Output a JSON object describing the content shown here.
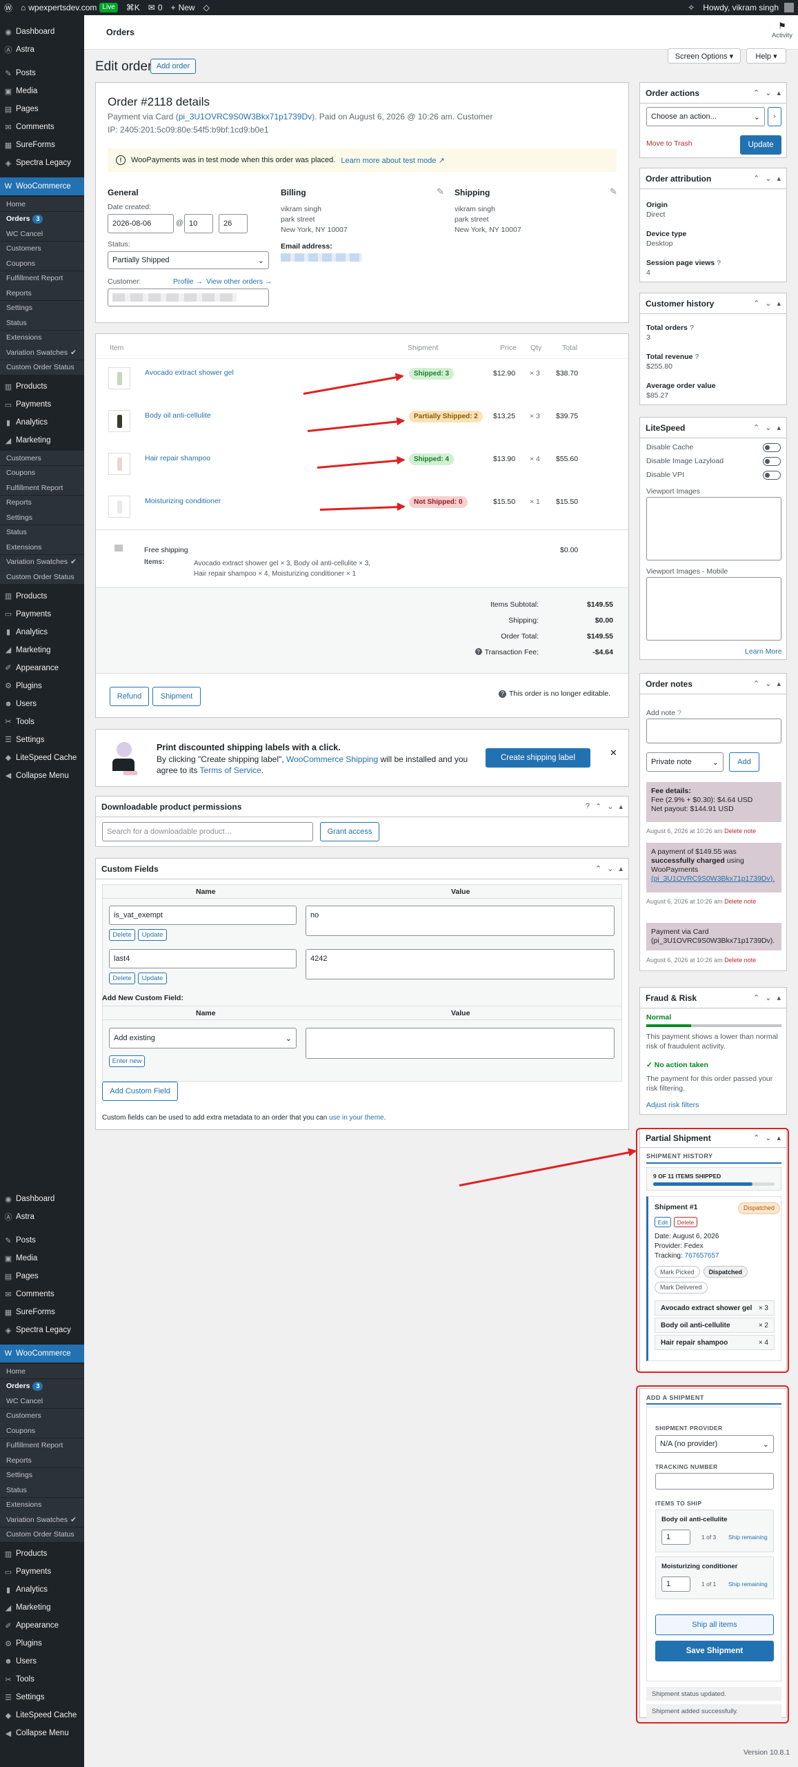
{
  "adminbar": {
    "site": "wpexpertsdev.com",
    "live": "Live",
    "shortcut": "⌘K",
    "comments": "0",
    "new": "New",
    "howdy": "Howdy, vikram singh"
  },
  "sidebar": {
    "group1": [
      {
        "label": "Dashboard",
        "icon": "dashboard-icon",
        "glyph": "◉"
      },
      {
        "label": "Astra",
        "icon": "astra-icon",
        "glyph": "Ⓐ"
      },
      {
        "label": "Posts",
        "icon": "pin-icon",
        "glyph": "✎"
      },
      {
        "label": "Media",
        "icon": "media-icon",
        "glyph": "▣"
      },
      {
        "label": "Pages",
        "icon": "pages-icon",
        "glyph": "▤"
      },
      {
        "label": "Comments",
        "icon": "comment-icon",
        "glyph": "✉"
      },
      {
        "label": "SureForms",
        "icon": "sureforms-icon",
        "glyph": "▦"
      },
      {
        "label": "Spectra Legacy",
        "icon": "spectra-icon",
        "glyph": "◈"
      },
      {
        "label": "WooCommerce",
        "icon": "woo-icon",
        "glyph": "W"
      }
    ],
    "woo_sub": [
      {
        "label": "Home"
      },
      {
        "label": "Orders",
        "badge": "3"
      },
      {
        "label": "WC Cancel"
      },
      {
        "label": "Customers"
      },
      {
        "label": "Coupons"
      },
      {
        "label": "Fulfillment Report"
      },
      {
        "label": "Reports"
      },
      {
        "label": "Settings"
      },
      {
        "label": "Status"
      },
      {
        "label": "Extensions"
      },
      {
        "label": "Variation Swatches",
        "star": "✔"
      },
      {
        "label": "Custom Order Status"
      }
    ],
    "group2": [
      {
        "label": "Products",
        "icon": "products-icon",
        "glyph": "▥"
      },
      {
        "label": "Payments",
        "icon": "payments-icon",
        "glyph": "▭"
      },
      {
        "label": "Analytics",
        "icon": "analytics-icon",
        "glyph": "▮"
      },
      {
        "label": "Marketing",
        "icon": "marketing-icon",
        "glyph": "◢"
      }
    ],
    "mkt_sub": [
      {
        "label": "Customers"
      },
      {
        "label": "Coupons"
      },
      {
        "label": "Fulfillment Report"
      },
      {
        "label": "Reports"
      },
      {
        "label": "Settings"
      },
      {
        "label": "Status"
      },
      {
        "label": "Extensions"
      },
      {
        "label": "Variation Swatches",
        "star": "✔"
      },
      {
        "label": "Custom Order Status"
      }
    ],
    "group3": [
      {
        "label": "Products",
        "icon": "products-icon",
        "glyph": "▥"
      },
      {
        "label": "Payments",
        "icon": "payments-icon",
        "glyph": "▭"
      },
      {
        "label": "Analytics",
        "icon": "analytics-icon",
        "glyph": "▮"
      },
      {
        "label": "Marketing",
        "icon": "marketing-icon",
        "glyph": "◢"
      },
      {
        "label": "Appearance",
        "icon": "brush-icon",
        "glyph": "✐"
      },
      {
        "label": "Plugins",
        "icon": "plugin-icon",
        "glyph": "⚙"
      },
      {
        "label": "Users",
        "icon": "users-icon",
        "glyph": "☻"
      },
      {
        "label": "Tools",
        "icon": "tools-icon",
        "glyph": "✂"
      },
      {
        "label": "Settings",
        "icon": "settings-icon",
        "glyph": "☰"
      },
      {
        "label": "LiteSpeed Cache",
        "icon": "litespeed-icon",
        "glyph": "◆"
      },
      {
        "label": "Collapse Menu",
        "icon": "collapse-icon",
        "glyph": "◀"
      }
    ]
  },
  "top": {
    "title": "Orders",
    "activity": "Activity",
    "screen_options": "Screen Options ▾",
    "help": "Help ▾"
  },
  "page": {
    "heading": "Edit order",
    "add_order": "Add order"
  },
  "order": {
    "title": "Order #2118 details",
    "payment_prefix": "Payment via Card (",
    "payment_link": "pi_3U1OVRC9S0W3Bkx71p1739Dv",
    "payment_suffix": "). Paid on August 6, 2026 @ 10:26 am. Customer",
    "ip": "IP: 2405:201:5c09:80e:54f5:b9bf:1cd9:b0e1",
    "notice": "WooPayments was in test mode when this order was placed.",
    "notice_link": "Learn more about test mode ↗",
    "general": "General",
    "date_label": "Date created:",
    "date": "2026-08-06",
    "at": "@",
    "hour": "10",
    "minute": "26",
    "status_label": "Status:",
    "status": "Partially Shipped",
    "customer_label": "Customer:",
    "profile": "Profile →",
    "view_orders": "View other orders →",
    "billing": "Billing",
    "billing_addr": [
      "vikram singh",
      "park street",
      "New York, NY 10007"
    ],
    "email_label": "Email address:",
    "shipping": "Shipping",
    "shipping_addr": [
      "vikram singh",
      "park street",
      "New York, NY 10007"
    ]
  },
  "items": {
    "col_item": "Item",
    "col_shipment": "Shipment",
    "col_price": "Price",
    "col_qty": "Qty",
    "col_total": "Total",
    "rows": [
      {
        "name": "Avocado extract shower gel",
        "status": "Shipped: 3",
        "kind": "green",
        "price": "$12.90",
        "qty": "× 3",
        "total": "$38.70"
      },
      {
        "name": "Body oil anti-cellulite",
        "status": "Partially Shipped: 2",
        "kind": "orange",
        "price": "$13.25",
        "qty": "× 3",
        "total": "$39.75"
      },
      {
        "name": "Hair repair shampoo",
        "status": "Shipped: 4",
        "kind": "green",
        "price": "$13.90",
        "qty": "× 4",
        "total": "$55.60"
      },
      {
        "name": "Moisturizing conditioner",
        "status": "Not Shipped: 0",
        "kind": "red",
        "price": "$15.50",
        "qty": "× 1",
        "total": "$15.50"
      }
    ],
    "shipping_name": "Free shipping",
    "shipping_total": "$0.00",
    "items_label": "Items:",
    "items_desc1": "Avocado extract shower gel × 3, Body oil anti-cellulite × 3,",
    "items_desc2": "Hair repair shampoo × 4, Moisturizing conditioner × 1",
    "totals": [
      {
        "label": "Items Subtotal:",
        "value": "$149.55"
      },
      {
        "label": "Shipping:",
        "value": "$0.00"
      },
      {
        "label": "Order Total:",
        "value": "$149.55"
      },
      {
        "label": "Transaction Fee:",
        "value": "-$4.64"
      }
    ],
    "refund": "Refund",
    "shipment_btn": "Shipment",
    "not_editable": "This order is no longer editable."
  },
  "promo": {
    "title": "Print discounted shipping labels with a click.",
    "line2a": "By clicking \"Create shipping label\", ",
    "line2link": "WooCommerce Shipping",
    "line2b": " will be installed and you",
    "line3a": "agree to its ",
    "line3link": "Terms of Service",
    "line3b": ".",
    "button": "Create shipping label",
    "close": "✕"
  },
  "downloads": {
    "title": "Downloadable product permissions",
    "placeholder": "Search for a downloadable product…",
    "grant": "Grant access"
  },
  "custom_fields": {
    "title": "Custom Fields",
    "col_name": "Name",
    "col_value": "Value",
    "rows": [
      {
        "key": "is_vat_exempt",
        "value": "no"
      },
      {
        "key": "last4",
        "value": "4242"
      }
    ],
    "delete": "Delete",
    "update": "Update",
    "add_new": "Add New Custom Field:",
    "select": "Add existing",
    "enter_new": "Enter new",
    "add_button": "Add Custom Field",
    "footer": "Custom fields can be used to add extra metadata to an order that you can ",
    "footer_link": "use in your theme",
    "footer_end": "."
  },
  "actions": {
    "title": "Order actions",
    "choose": "Choose an action...",
    "trash": "Move to Trash",
    "update": "Update"
  },
  "attribution": {
    "title": "Order attribution",
    "origin_label": "Origin",
    "origin": "Direct",
    "device_label": "Device type",
    "device": "Desktop",
    "session_label": "Session page views",
    "session": "4"
  },
  "history": {
    "title": "Customer history",
    "total_orders_label": "Total orders",
    "total_orders": "3",
    "revenue_label": "Total revenue",
    "revenue": "$255.80",
    "aov_label": "Average order value",
    "aov": "$85.27"
  },
  "litespeed": {
    "title": "LiteSpeed",
    "opts": [
      "Disable Cache",
      "Disable Image Lazyload",
      "Disable VPI"
    ],
    "viewport": "Viewport Images",
    "viewport_mobile": "Viewport Images - Mobile",
    "learn": "Learn More"
  },
  "notes": {
    "title": "Order notes",
    "add_label": "Add note",
    "type": "Private note",
    "add": "Add",
    "n1": {
      "l1": "Fee details:",
      "l2": "Fee (2.9% + $0.30): $4.64 USD",
      "l3": "Net payout: $144.91 USD",
      "meta": "August 6, 2026 at 10:26 am"
    },
    "n2": {
      "l1": "A payment of $149.55 was",
      "l2": "successfully charged",
      "l3": " using",
      "l4": "WooPayments",
      "l5": "(pi_3U1OVRC9S0W3Bkx71p1739Dv).",
      "meta": "August 6, 2026 at 10:26 am"
    },
    "n3": {
      "l1": "Payment via Card",
      "l2": "(pi_3U1OVRC9S0W3Bkx71p1739Dv).",
      "meta": "August 6, 2026 at 10:26 am"
    },
    "delete": "Delete note"
  },
  "fraud": {
    "title": "Fraud & Risk",
    "level": "Normal",
    "level_fill": 0.33,
    "desc": "This payment shows a lower than normal risk of fraudulent activity.",
    "action": "No action taken",
    "action_desc": "The payment for this order passed your risk filtering.",
    "adjust": "Adjust risk filters"
  },
  "partial": {
    "title": "Partial Shipment",
    "history_label": "SHIPMENT HISTORY",
    "progress_text": "9 OF 11 ITEMS SHIPPED",
    "progress": 0.818,
    "shipment": {
      "title": "Shipment #1",
      "status": "Dispatched",
      "edit": "Edit",
      "delete": "Delete",
      "date": "Date: August 6, 2026",
      "provider": "Provider: Fedex",
      "tracking_label": "Tracking: ",
      "tracking": "767657657",
      "mark_picked": "Mark Picked",
      "dispatched": "Dispatched",
      "mark_delivered": "Mark Delivered",
      "items": [
        {
          "name": "Avocado extract shower gel",
          "qty": "× 3"
        },
        {
          "name": "Body oil anti-cellulite",
          "qty": "× 2"
        },
        {
          "name": "Hair repair shampoo",
          "qty": "× 4"
        }
      ]
    },
    "add_label": "ADD A SHIPMENT",
    "provider_label": "SHIPMENT PROVIDER",
    "provider": "N/A (no provider)",
    "tracking_label": "TRACKING NUMBER",
    "items_label": "ITEMS TO SHIP",
    "ship_items": [
      {
        "name": "Body oil anti-cellulite",
        "qty": "1",
        "of": "1 of 3",
        "remain": "Ship remaining"
      },
      {
        "name": "Moisturizing conditioner",
        "qty": "1",
        "of": "1 of 1",
        "remain": "Ship remaining"
      }
    ],
    "ship_all": "Ship all items",
    "save": "Save Shipment",
    "msg1": "Shipment status updated.",
    "msg2": "Shipment added successfully."
  },
  "footer": {
    "version": "Version 10.8.1"
  },
  "colors": {
    "accent": "#2271b1",
    "annotation": "#e02020",
    "sidebar": "#1d2327"
  }
}
